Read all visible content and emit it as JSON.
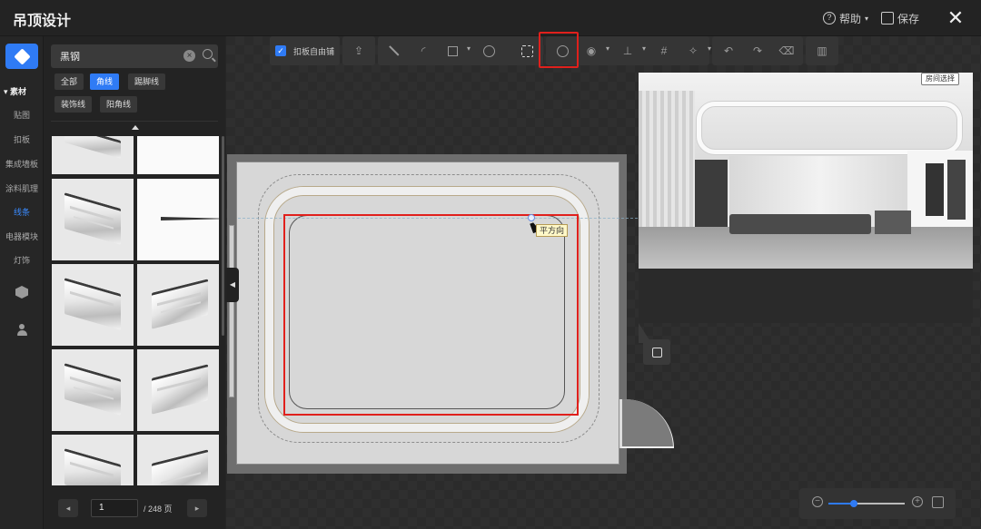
{
  "window": {
    "title": "吊顶设计",
    "help_label": "帮助",
    "save_label": "保存"
  },
  "rail": {
    "section_title": "素材",
    "categories": [
      "贴图",
      "扣板",
      "集成墙板",
      "涂料肌理",
      "线条",
      "电器模块",
      "灯饰"
    ],
    "selected_category": "线条"
  },
  "panel": {
    "search": {
      "value": "黑钢"
    },
    "filters": [
      "全部",
      "角线",
      "踢脚线",
      "装饰线",
      "阳角线"
    ],
    "active_filter": "角线",
    "pager": {
      "current": "1",
      "total": "/ 248 页"
    }
  },
  "toolbar": {
    "snap_checkbox": {
      "label": "扣板自由铺",
      "checked": true
    },
    "tools": [
      "upload-icon",
      "line-icon",
      "arc-icon",
      "rectangle-icon",
      "circle-icon",
      "offset-frame-icon",
      "ring-icon",
      "eye-icon",
      "align-icon",
      "grid-icon",
      "magic-icon",
      "undo-icon",
      "redo-icon",
      "eraser-icon",
      "map-icon"
    ]
  },
  "canvas": {
    "tooltip": "平方向"
  },
  "preview": {
    "button_label": "房间选择"
  },
  "zoom": {
    "level": 0.33
  },
  "colors": {
    "accent": "#2f7bf5",
    "highlight": "#e0201c"
  }
}
